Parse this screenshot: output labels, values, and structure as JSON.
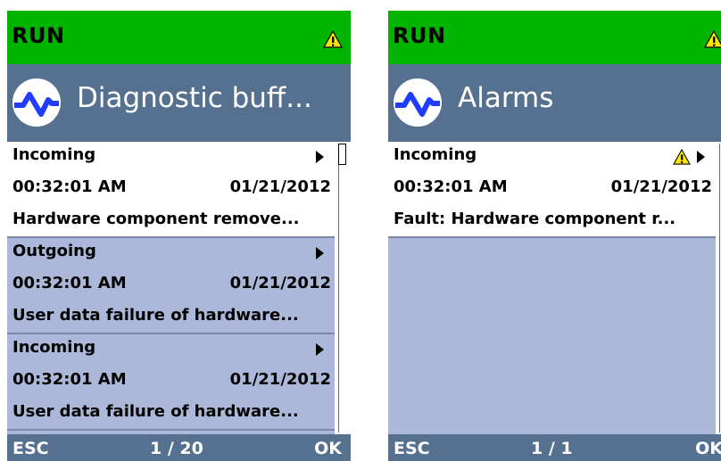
{
  "screens": [
    {
      "status": "RUN",
      "title": "Diagnostic buff...",
      "entries": [
        {
          "direction": "Incoming",
          "time": "00:32:01 AM",
          "date": "01/21/2012",
          "message": "Hardware component remove...",
          "selected": true
        },
        {
          "direction": "Outgoing",
          "time": "00:32:01 AM",
          "date": "01/21/2012",
          "message": "User data failure of hardware...",
          "selected": false
        },
        {
          "direction": "Incoming",
          "time": "00:32:01 AM",
          "date": "01/21/2012",
          "message": "User data failure of hardware...",
          "selected": false
        }
      ],
      "footer": {
        "esc": "ESC",
        "page": "1 / 20",
        "ok": "OK"
      }
    },
    {
      "status": "RUN",
      "title": "Alarms",
      "entries": [
        {
          "direction": "Incoming",
          "time": "00:32:01 AM",
          "date": "01/21/2012",
          "message": "Fault: Hardware component r...",
          "selected": true,
          "icon": "warning-icon"
        }
      ],
      "footer": {
        "esc": "ESC",
        "page": "1 / 1",
        "ok": "OK"
      }
    }
  ],
  "colors": {
    "status_green": "#00b500",
    "title_blue": "#56708f",
    "list_blue": "#abb8d9",
    "selected_bg": "#ffffff",
    "warning_yellow": "#ffe600"
  },
  "icons": {
    "status": "warning-icon",
    "logo": "pulse-wave-icon",
    "row": "play-arrow-icon"
  }
}
